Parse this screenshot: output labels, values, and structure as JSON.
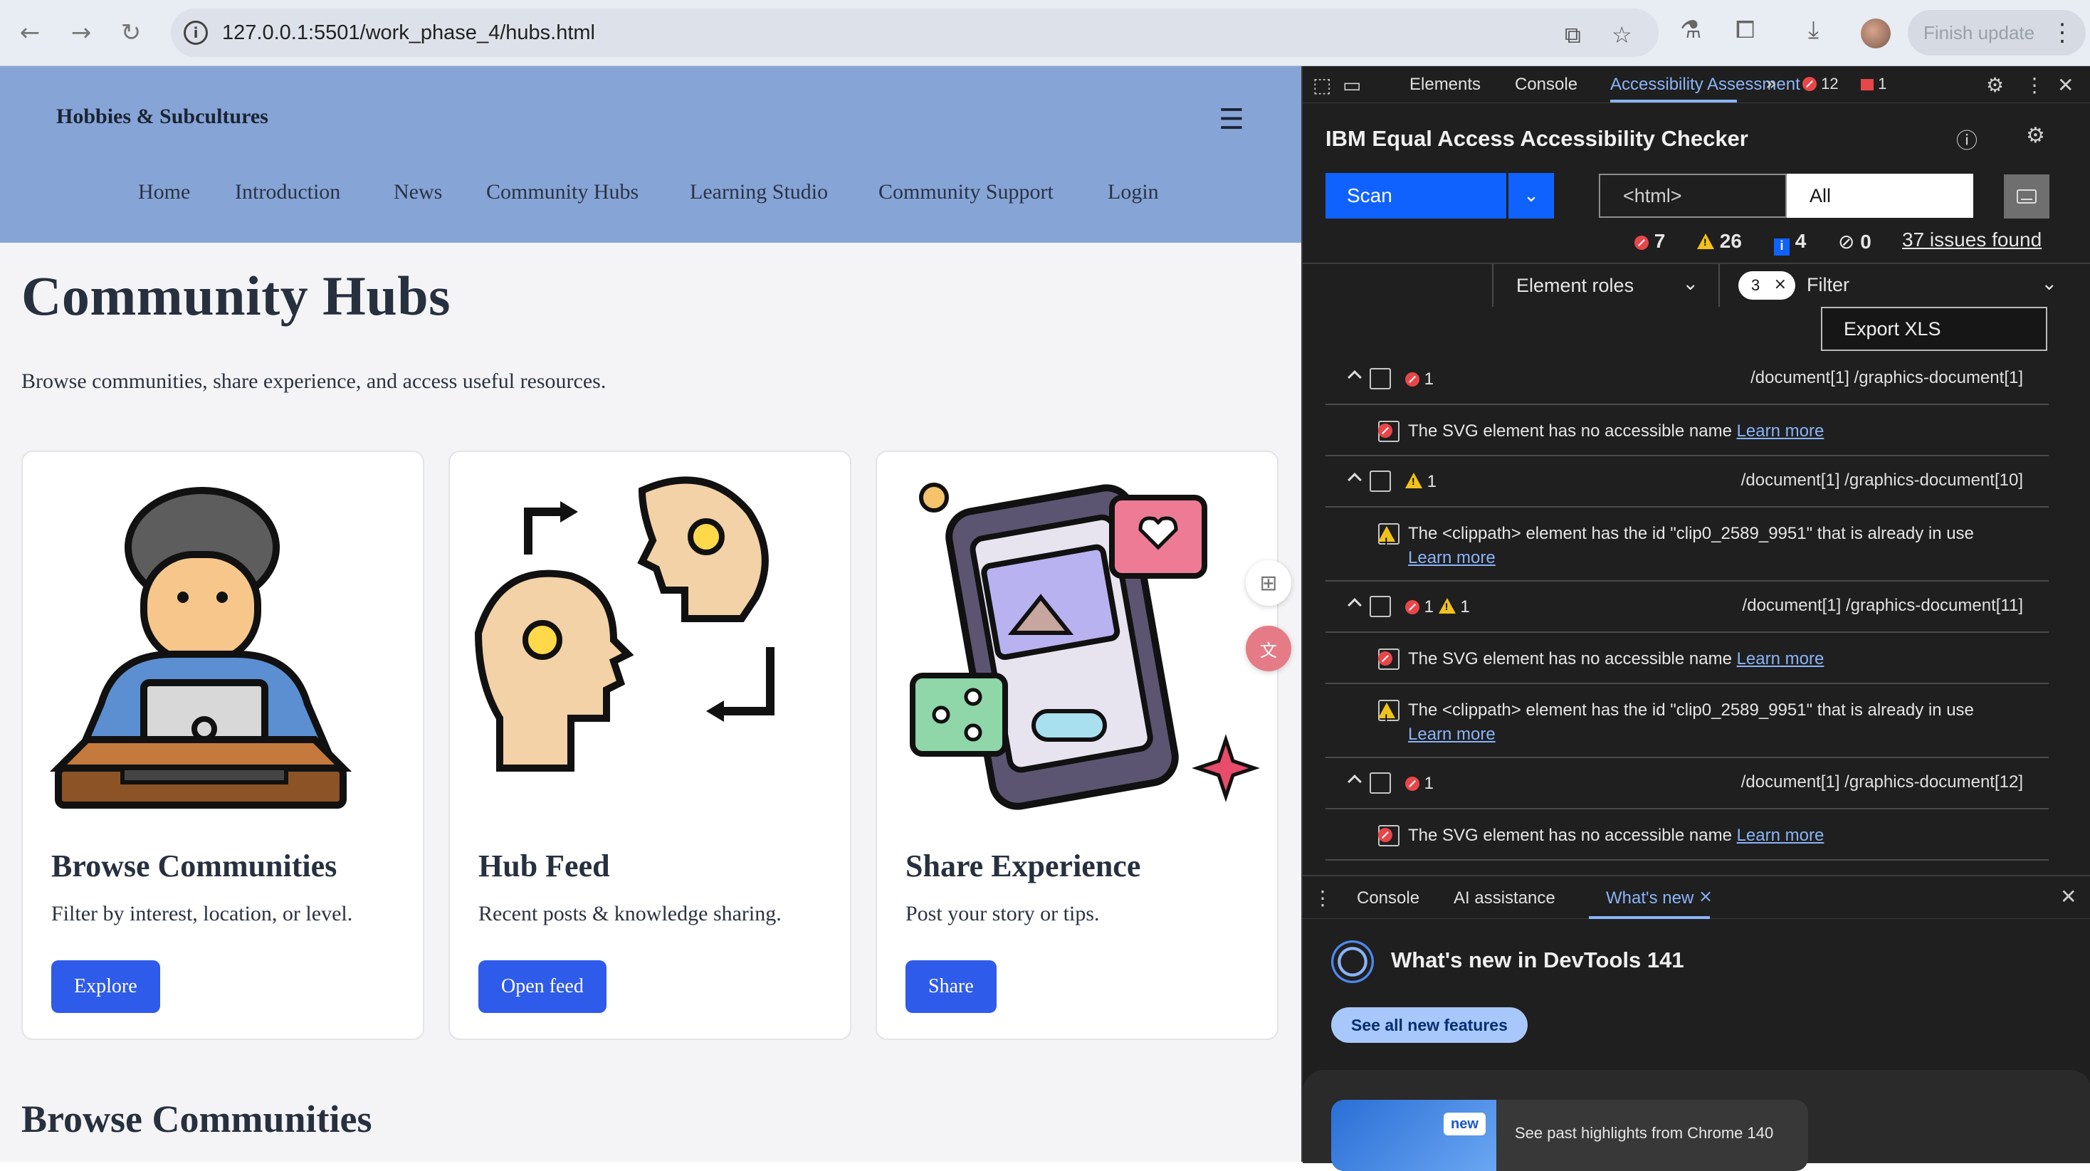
{
  "browser": {
    "url": "127.0.0.1:5501/work_phase_4/hubs.html",
    "finish_update_label": "Finish update"
  },
  "site": {
    "brand": "Hobbies & Subcultures",
    "nav": [
      "Home",
      "Introduction",
      "News",
      "Community Hubs",
      "Learning Studio",
      "Community Support",
      "Login"
    ],
    "title": "Community Hubs",
    "intro": "Browse communities, share experience, and access useful resources.",
    "cards": [
      {
        "title": "Browse Communities",
        "desc": "Filter by interest, location, or level.",
        "button": "Explore"
      },
      {
        "title": "Hub Feed",
        "desc": "Recent posts & knowledge sharing.",
        "button": "Open feed"
      },
      {
        "title": "Share Experience",
        "desc": "Post your story or tips.",
        "button": "Share"
      }
    ],
    "section_heading": "Browse Communities"
  },
  "devtools": {
    "tabs": [
      "Elements",
      "Console",
      "Accessibility Assessment"
    ],
    "error_count": "12",
    "issue_badge_count": "1",
    "checker_title": "IBM Equal Access Accessibility Checker",
    "scan_label": "Scan",
    "scope_input": "<html>",
    "scope_select": "All",
    "counts": {
      "violations": "7",
      "needs_review": "26",
      "recommendations": "4",
      "hidden": "0"
    },
    "issues_found": "37 issues found",
    "element_roles_label": "Element roles",
    "filter_tag_count": "3",
    "filter_label": "Filter",
    "export_label": "Export XLS",
    "learn_more": "Learn more",
    "groups": [
      {
        "count_v": "1",
        "xpath": "/document[1] /graphics-document[1]",
        "msg": "The SVG element has no accessible name "
      },
      {
        "count_w": "1",
        "xpath": "/document[1] /graphics-document[10]",
        "msg": "The <clippath> element has the id \"clip0_2589_9951\" that is already in use "
      },
      {
        "count_v": "1",
        "count_w": "1",
        "xpath": "/document[1] /graphics-document[11]",
        "msg1": "The SVG element has no accessible name ",
        "msg2": "The <clippath> element has the id \"clip0_2589_9951\" that is already in use "
      },
      {
        "count_v": "1",
        "xpath": "/document[1] /graphics-document[12]",
        "msg": "The SVG element has no accessible name "
      }
    ],
    "drawer": {
      "tabs": [
        "Console",
        "AI assistance",
        "What's new"
      ],
      "whats_new_title": "What's new in DevTools 141",
      "see_all": "See all new features",
      "new_badge": "new",
      "highlights": "See past highlights from Chrome 140"
    }
  },
  "colors": {
    "accent": "#2f5bea",
    "header_bg": "#86a4d6",
    "devtools_bg": "#1f1f1f",
    "ibm_blue": "#0f62fe"
  }
}
